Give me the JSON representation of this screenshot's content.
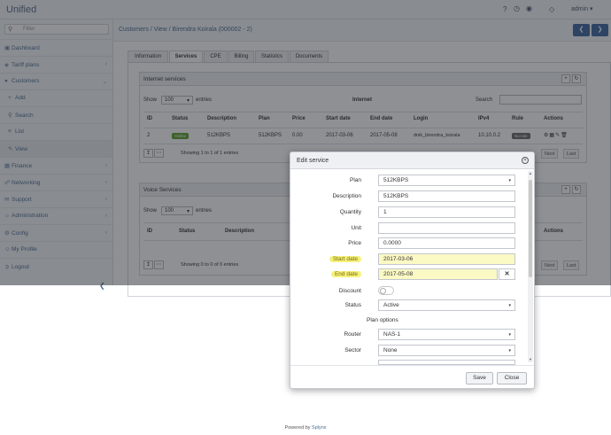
{
  "app": {
    "title": "Unified",
    "user": "admin"
  },
  "header": {
    "icons": [
      "help-icon",
      "clock-icon",
      "globe-icon",
      "bell-icon"
    ]
  },
  "sidebar": {
    "search_placeholder": "Filter",
    "items": [
      {
        "label": "Dashboard",
        "icon": "dashboard-icon"
      },
      {
        "label": "Tariff plans",
        "icon": "tag-icon",
        "chevron": "‹"
      },
      {
        "label": "Customers",
        "icon": "users-icon",
        "chevron": "⌄"
      },
      {
        "label": "Add",
        "icon": "plus-icon"
      },
      {
        "label": "Search",
        "icon": "search-icon"
      },
      {
        "label": "List",
        "icon": "list-icon"
      },
      {
        "label": "View",
        "icon": "pencil-icon"
      },
      {
        "label": "Finance",
        "icon": "finance-icon",
        "chevron": "‹"
      },
      {
        "label": "Networking",
        "icon": "network-icon",
        "chevron": "‹"
      },
      {
        "label": "Support",
        "icon": "support-icon",
        "chevron": "‹"
      },
      {
        "label": "Administration",
        "icon": "admin-icon",
        "chevron": "‹"
      },
      {
        "label": "Config",
        "icon": "gear-icon",
        "chevron": "‹"
      },
      {
        "label": "My Profile",
        "icon": "profile-icon"
      },
      {
        "label": "Logout",
        "icon": "logout-icon"
      }
    ]
  },
  "breadcrumb": "Customers / View / Birendra Koirala (000002 - 2)",
  "tabs": [
    "Information",
    "Services",
    "CPE",
    "Billing",
    "Statistics",
    "Documents"
  ],
  "internet": {
    "title": "Internet services",
    "table_caption": "Internet",
    "show_label": "Show",
    "show_value": "100",
    "entries_label": "entries",
    "search_label": "Search",
    "columns": [
      "ID",
      "Status",
      "Description",
      "Plan",
      "Price",
      "Start date",
      "End date",
      "Login",
      "IPv4",
      "Rule",
      "Actions"
    ],
    "row": {
      "id": "2",
      "status": "Online",
      "description": "512KBPS",
      "plan": "512KBPS",
      "price": "0.00",
      "start": "2017-03-06",
      "end": "2017-05-08",
      "login": "dnik_birendra_koirala",
      "ipv4": "10.10.0.2",
      "rule": "No rule"
    },
    "info": "Showing 1 to 1 of 1 entries",
    "pager": [
      "Next",
      "Last"
    ]
  },
  "voice": {
    "title": "Voice Services",
    "show_label": "Show",
    "show_value": "100",
    "entries_label": "entries",
    "columns": [
      "ID",
      "Status",
      "Description",
      "Actions"
    ],
    "info": "Showing 0 to 0 of 0 entries",
    "pager": [
      "Next",
      "Last"
    ]
  },
  "modal": {
    "title": "Edit service",
    "fields": {
      "plan": {
        "label": "Plan",
        "value": "512KBPS"
      },
      "description": {
        "label": "Description",
        "value": "512KBPS"
      },
      "quantity": {
        "label": "Quantity",
        "value": "1"
      },
      "unit": {
        "label": "Unit",
        "value": ""
      },
      "price": {
        "label": "Price",
        "value": "0.0000"
      },
      "start_date": {
        "label": "Start date",
        "value": "2017-03-06"
      },
      "end_date": {
        "label": "End date",
        "value": "2017-05-08"
      },
      "discount": {
        "label": "Discount"
      },
      "status": {
        "label": "Status",
        "value": "Active"
      },
      "router": {
        "label": "Router",
        "value": "NAS-1"
      },
      "sector": {
        "label": "Sector",
        "value": "None"
      }
    },
    "section_plan_options": "Plan options",
    "save_label": "Save",
    "close_label": "Close"
  },
  "footer": {
    "text": "Powered by",
    "brand": "Splynx"
  },
  "colors": {
    "accent": "#3d67a3",
    "highlight": "#f5f27a",
    "online": "#5aa02c"
  }
}
